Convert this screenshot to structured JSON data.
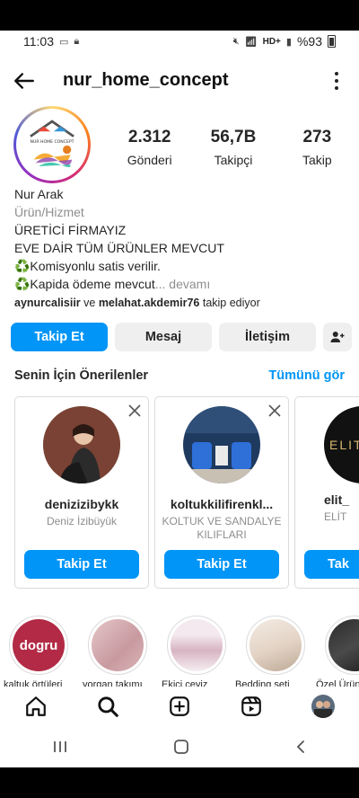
{
  "status": {
    "time": "11:03",
    "net": "HD+",
    "battery": "%93"
  },
  "header": {
    "username": "nur_home_concept"
  },
  "avatar": {
    "logo_text": "NUR HOME CONCEPT"
  },
  "stats": [
    {
      "value": "2.312",
      "label": "Gönderi"
    },
    {
      "value": "56,7B",
      "label": "Takipçi"
    },
    {
      "value": "273",
      "label": "Takip"
    }
  ],
  "bio": {
    "name": "Nur Arak",
    "category": "Ürün/Hizmet",
    "line1": "ÜRETİCİ FİRMAYIZ",
    "line2": "EVE DAİR TÜM ÜRÜNLER MEVCUT",
    "line3": "♻️Komisyonlu satis verilir.",
    "line4": "♻️Kapida ödeme mevcut",
    "more": "... devamı"
  },
  "followed_by": {
    "user1": "aynurcalisiir",
    "joiner": " ve ",
    "user2": "melahat.akdemir76",
    "suffix": " takip ediyor"
  },
  "buttons": {
    "follow": "Takip Et",
    "message": "Mesaj",
    "contact": "İletişim"
  },
  "suggestions": {
    "title": "Senin İçin Önerilenler",
    "see_all": "Tümünü gör",
    "cards": [
      {
        "username": "denizizibykk",
        "subtitle": "Deniz İzibüyük",
        "button": "Takip Et"
      },
      {
        "username": "koltukkilifirenkl...",
        "subtitle": "KOLTUK VE SANDALYE KILIFLARI",
        "button": "Takip Et"
      },
      {
        "username": "elit_",
        "subtitle": "ELİT",
        "button": "Tak"
      }
    ],
    "third_avatar_text": "ELIT"
  },
  "highlights": [
    {
      "label": "kaltuk örtüleri",
      "text": "dogru"
    },
    {
      "label": "yorgan takımı",
      "text": ""
    },
    {
      "label": "Ekici ceyiz",
      "text": ""
    },
    {
      "label": "Bedding seti",
      "text": ""
    },
    {
      "label": "Özel Ürün",
      "text": ""
    }
  ],
  "colors": {
    "accent": "#0095f6",
    "text": "#262626",
    "muted": "#8e8e8e"
  }
}
